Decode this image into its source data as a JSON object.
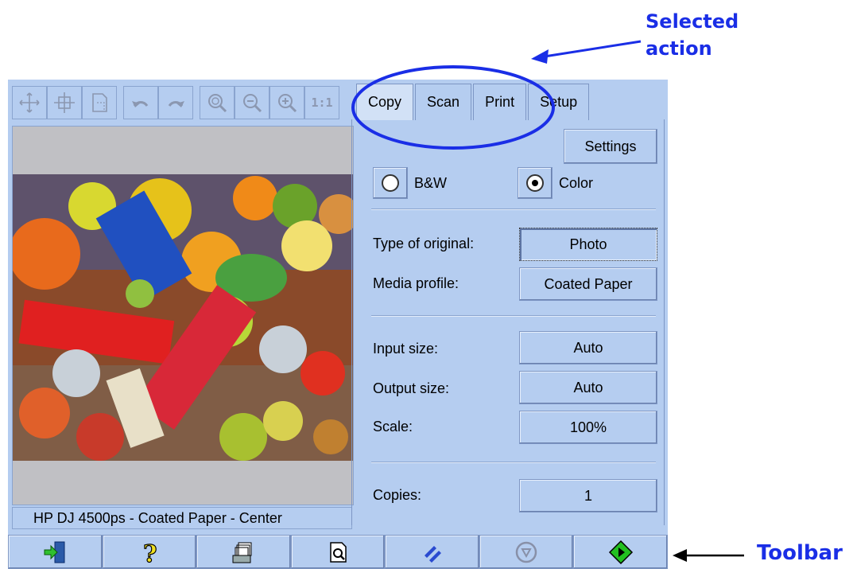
{
  "annotations": {
    "selected_action_line1": "Selected",
    "selected_action_line2": "action",
    "toolbar": "Toolbar"
  },
  "icon_toolbar": [
    {
      "icon": "pan-icon"
    },
    {
      "icon": "move-icon"
    },
    {
      "icon": "page-crop-icon"
    },
    {
      "icon": "rotate-left-icon"
    },
    {
      "icon": "rotate-right-icon"
    },
    {
      "icon": "zoom-fit-icon"
    },
    {
      "icon": "zoom-out-icon"
    },
    {
      "icon": "zoom-in-icon"
    },
    {
      "icon": "actual-size-icon",
      "label": "1:1"
    }
  ],
  "tabs": [
    {
      "label": "Copy",
      "active": true
    },
    {
      "label": "Scan",
      "active": false
    },
    {
      "label": "Print",
      "active": false
    },
    {
      "label": "Setup",
      "active": false
    }
  ],
  "settings_button": "Settings",
  "color_mode": {
    "bw_label": "B&W",
    "color_label": "Color",
    "selected": "Color"
  },
  "fields": {
    "type_of_original": {
      "label": "Type of original:",
      "value": "Photo"
    },
    "media_profile": {
      "label": "Media profile:",
      "value": "Coated Paper"
    },
    "input_size": {
      "label": "Input size:",
      "value": "Auto"
    },
    "output_size": {
      "label": "Output size:",
      "value": "Auto"
    },
    "scale": {
      "label": "Scale:",
      "value": "100%"
    },
    "copies": {
      "label": "Copies:",
      "value": "1"
    }
  },
  "status_bar": "HP DJ 4500ps - Coated Paper - Center",
  "bottom_toolbar": [
    {
      "icon": "exit-icon"
    },
    {
      "icon": "help-icon"
    },
    {
      "icon": "printer-queue-icon"
    },
    {
      "icon": "print-preview-icon"
    },
    {
      "icon": "reset-icon"
    },
    {
      "icon": "stop-icon"
    },
    {
      "icon": "start-icon"
    }
  ],
  "colors": {
    "panel_bg": "#b5cdf0",
    "annotation_blue": "#1a2ee6",
    "start_green": "#22c020"
  }
}
